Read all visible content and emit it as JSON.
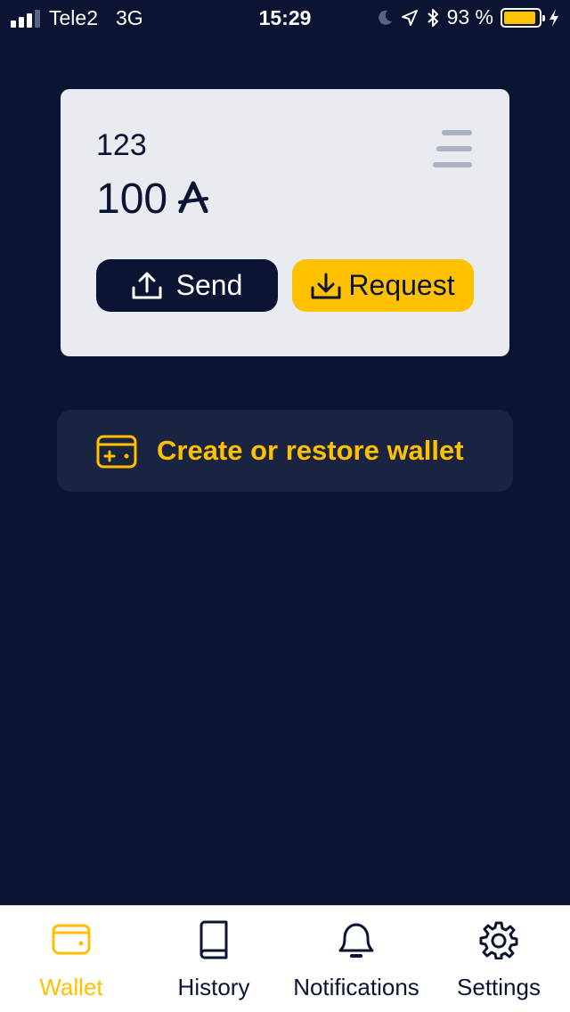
{
  "status_bar": {
    "carrier": "Tele2",
    "network": "3G",
    "time": "15:29",
    "battery_percent_label": "93 %",
    "battery_level": 0.93,
    "icons": [
      "moon-icon",
      "location-arrow-icon",
      "bluetooth-icon",
      "charging-bolt-icon"
    ]
  },
  "wallet_card": {
    "name": "123",
    "balance": "100",
    "currency_icon": "currency-a-icon",
    "menu_icon": "menu-icon",
    "send_label": "Send",
    "request_label": "Request"
  },
  "create_wallet": {
    "label": "Create or restore wallet",
    "icon": "wallet-plus-icon"
  },
  "tab_bar": {
    "tabs": [
      {
        "label": "Wallet",
        "icon": "wallet-icon",
        "active": true
      },
      {
        "label": "History",
        "icon": "book-icon",
        "active": false
      },
      {
        "label": "Notifications",
        "icon": "bell-icon",
        "active": false
      },
      {
        "label": "Settings",
        "icon": "gear-icon",
        "active": false
      }
    ]
  },
  "colors": {
    "background": "#0b1433",
    "card": "#e8ebef",
    "accent": "#ffc000",
    "dark": "#0b1433",
    "panel": "#1a2340"
  }
}
